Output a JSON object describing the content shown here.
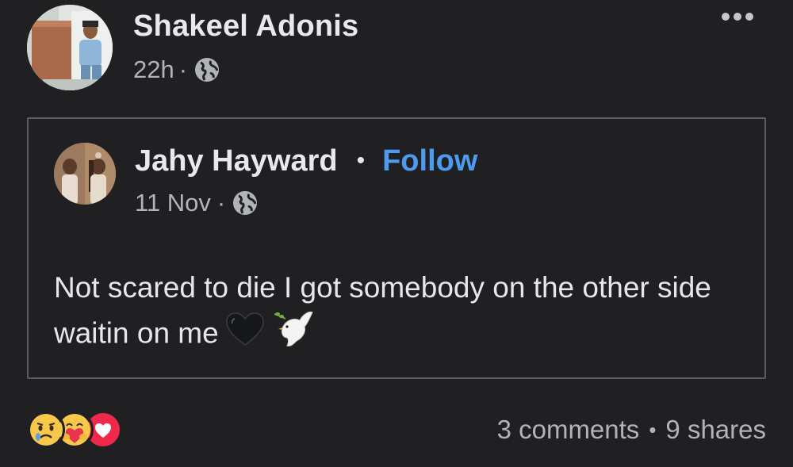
{
  "post": {
    "author": "Shakeel Adonis",
    "time": "22h",
    "separator": "·",
    "privacy_icon": "globe-icon",
    "more_icon": "more-options-icon"
  },
  "shared": {
    "author": "Jahy Hayward",
    "dot": "•",
    "follow_label": "Follow",
    "date": "11 Nov",
    "separator": "·",
    "privacy_icon": "globe-icon",
    "text": "Not scared to die I got somebody on the other side waitin on me",
    "emojis": [
      "black-heart-icon",
      "dove-icon"
    ]
  },
  "footer": {
    "reactions": [
      "sad-reaction-icon",
      "care-reaction-icon",
      "love-reaction-icon"
    ],
    "comments": "3 comments",
    "dot": "•",
    "shares": "9 shares"
  },
  "colors": {
    "background": "#202022",
    "link_blue": "#4d9bf0",
    "muted": "#b0b3b8",
    "border": "#5a5c60"
  }
}
